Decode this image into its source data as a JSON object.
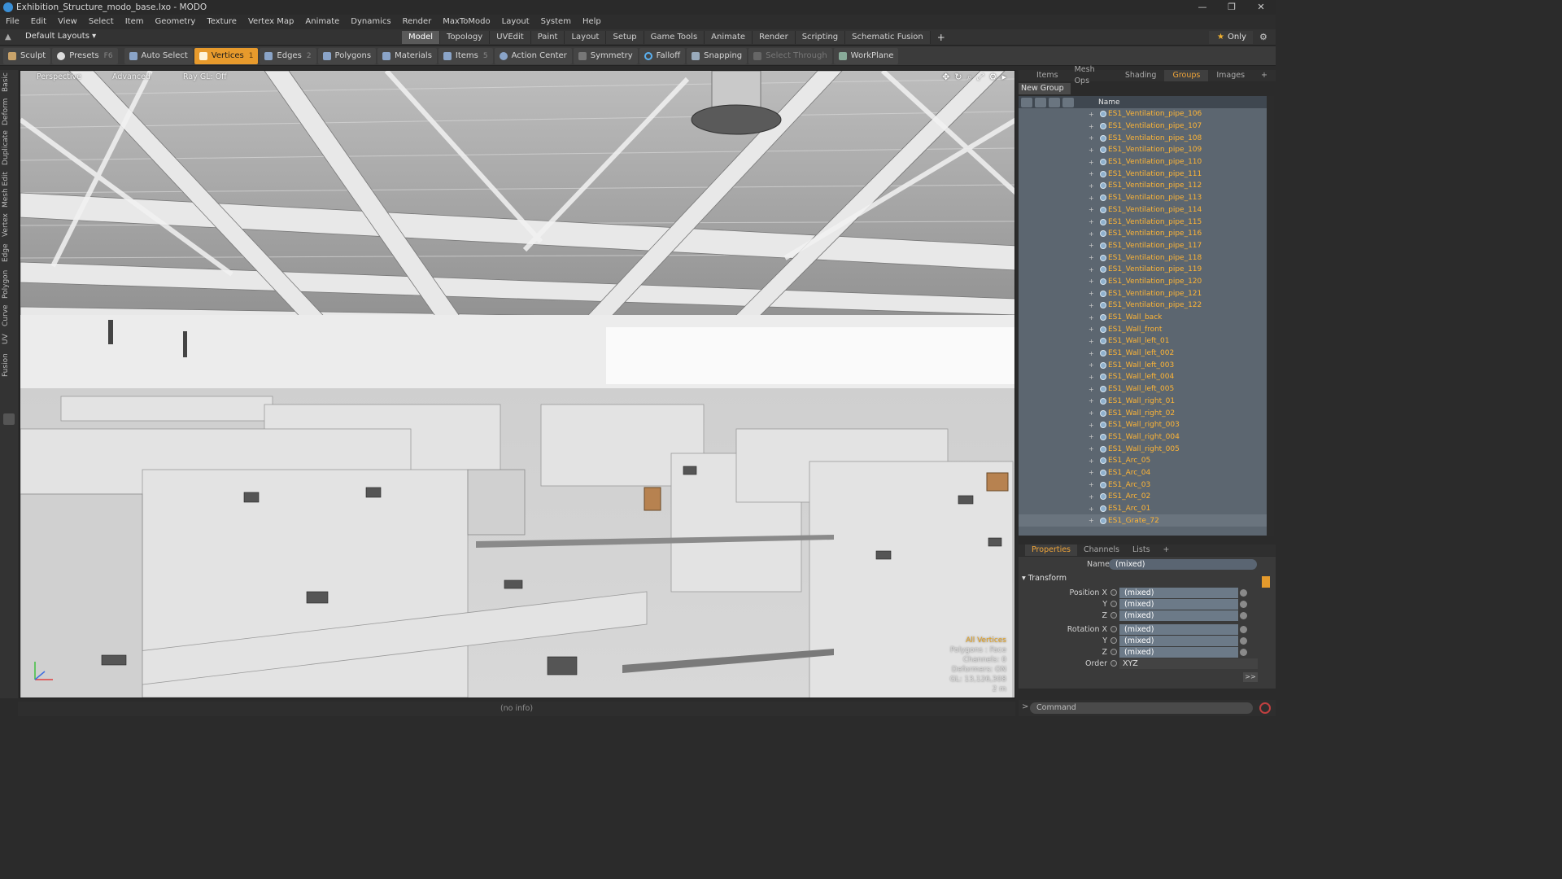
{
  "window": {
    "title": "Exhibition_Structure_modo_base.lxo - MODO",
    "controls": [
      "—",
      "❐",
      "✕"
    ]
  },
  "menu": [
    "File",
    "Edit",
    "View",
    "Select",
    "Item",
    "Geometry",
    "Texture",
    "Vertex Map",
    "Animate",
    "Dynamics",
    "Render",
    "MaxToModo",
    "Layout",
    "System",
    "Help"
  ],
  "layout": {
    "preset": "Default Layouts ▾",
    "tabs": [
      "Model",
      "Topology",
      "UVEdit",
      "Paint",
      "Layout",
      "Setup",
      "Game Tools",
      "Animate",
      "Render",
      "Scripting",
      "Schematic Fusion"
    ],
    "active_tab": "Model",
    "only_label": "Only"
  },
  "toolbar": {
    "sculpt": "Sculpt",
    "presets": "Presets",
    "presets_key": "F6",
    "auto_select": "Auto Select",
    "vertices": "Vertices",
    "vertices_key": "1",
    "edges": "Edges",
    "edges_key": "2",
    "polygons": "Polygons",
    "materials": "Materials",
    "items": "Items",
    "items_key": "5",
    "action_center": "Action Center",
    "symmetry": "Symmetry",
    "falloff": "Falloff",
    "snapping": "Snapping",
    "select_through": "Select Through",
    "workplane": "WorkPlane"
  },
  "left_tabs": [
    "Basic",
    "Deform",
    "Duplicate",
    "Mesh Edit",
    "Vertex",
    "Edge",
    "Polygon",
    "Curve",
    "UV",
    "Fusion"
  ],
  "viewport": {
    "view": "Perspective",
    "shading": "Advanced",
    "ray_gl": "Ray GL: Off",
    "info": {
      "mode": "All Vertices",
      "polygons": "Polygons : Face",
      "channels": "Channels: 0",
      "deformers": "Deformers: ON",
      "gl": "GL: 13,126,308",
      "scale": "2 m"
    }
  },
  "status": "(no info)",
  "right_tabs": [
    "Items",
    "Mesh Ops",
    "Shading",
    "Groups",
    "Images",
    "+"
  ],
  "right_active": "Groups",
  "groups": {
    "new_group": "New Group",
    "column": "Name",
    "items": [
      "ES1_Ventilation_pipe_106",
      "ES1_Ventilation_pipe_107",
      "ES1_Ventilation_pipe_108",
      "ES1_Ventilation_pipe_109",
      "ES1_Ventilation_pipe_110",
      "ES1_Ventilation_pipe_111",
      "ES1_Ventilation_pipe_112",
      "ES1_Ventilation_pipe_113",
      "ES1_Ventilation_pipe_114",
      "ES1_Ventilation_pipe_115",
      "ES1_Ventilation_pipe_116",
      "ES1_Ventilation_pipe_117",
      "ES1_Ventilation_pipe_118",
      "ES1_Ventilation_pipe_119",
      "ES1_Ventilation_pipe_120",
      "ES1_Ventilation_pipe_121",
      "ES1_Ventilation_pipe_122",
      "ES1_Wall_back",
      "ES1_Wall_front",
      "ES1_Wall_left_01",
      "ES1_Wall_left_002",
      "ES1_Wall_left_003",
      "ES1_Wall_left_004",
      "ES1_Wall_left_005",
      "ES1_Wall_right_01",
      "ES1_Wall_right_02",
      "ES1_Wall_right_003",
      "ES1_Wall_right_004",
      "ES1_Wall_right_005",
      "ES1_Arc_05",
      "ES1_Arc_04",
      "ES1_Arc_03",
      "ES1_Arc_02",
      "ES1_Arc_01",
      "ES1_Grate_72"
    ]
  },
  "prop_tabs": [
    "Properties",
    "Channels",
    "Lists",
    "+"
  ],
  "prop_active": "Properties",
  "properties": {
    "name_label": "Name",
    "name_value": "(mixed)",
    "transform": "Transform",
    "rows": [
      {
        "label": "Position X",
        "value": "(mixed)"
      },
      {
        "label": "Y",
        "value": "(mixed)"
      },
      {
        "label": "Z",
        "value": "(mixed)"
      },
      {
        "label": "Rotation X",
        "value": "(mixed)"
      },
      {
        "label": "Y",
        "value": "(mixed)"
      },
      {
        "label": "Z",
        "value": "(mixed)"
      }
    ],
    "order_label": "Order",
    "order_value": "XYZ",
    "more": ">>"
  },
  "command": {
    "placeholder": "Command"
  },
  "colors": {
    "accent": "#e79a2c",
    "group_text": "#ffb535",
    "tab_active": "#f0a53a"
  }
}
